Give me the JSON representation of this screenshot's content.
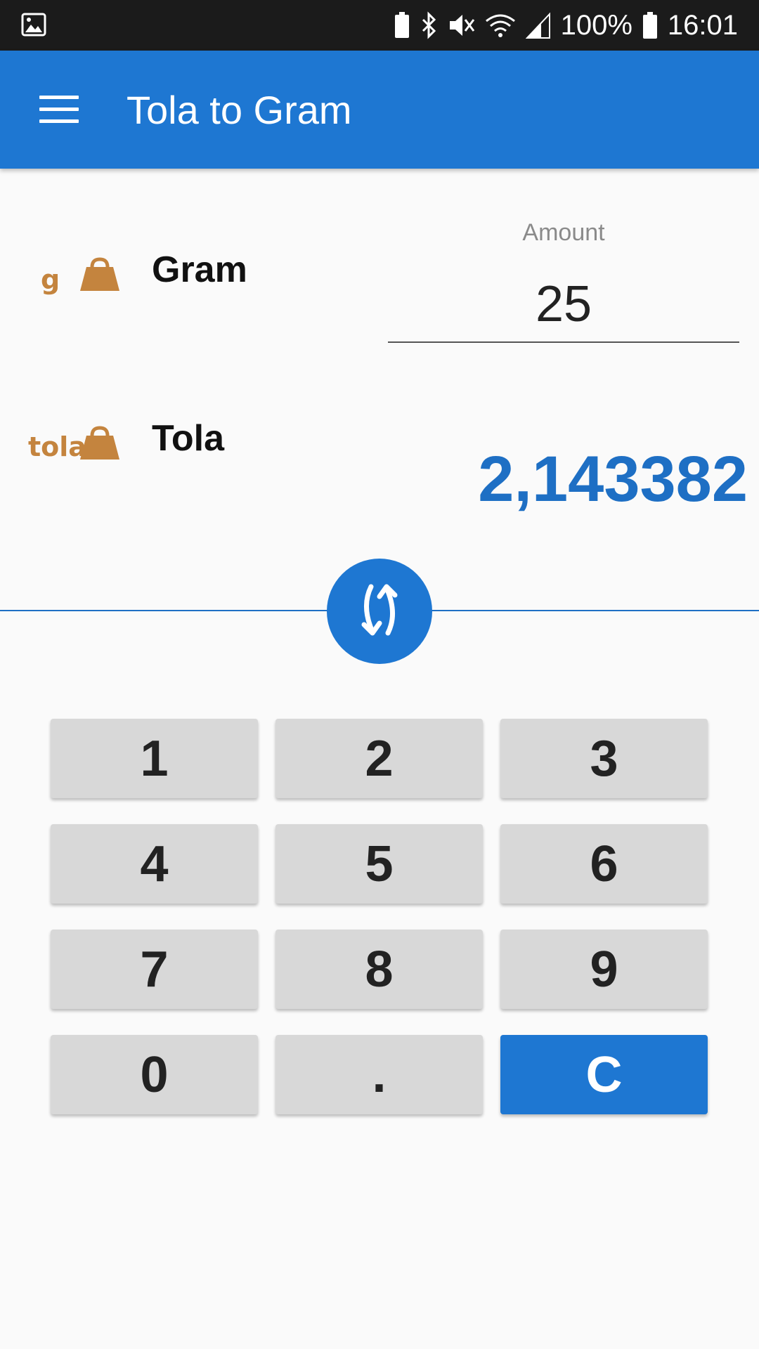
{
  "status_bar": {
    "battery": "100%",
    "time": "16:01"
  },
  "app_bar": {
    "title": "Tola to Gram",
    "menu_icon": "hamburger-menu-icon"
  },
  "from_unit": {
    "abbr": "g",
    "name": "Gram",
    "icon": "weight-icon"
  },
  "to_unit": {
    "abbr": "tola",
    "name": "Tola",
    "icon": "weight-icon"
  },
  "amount": {
    "label": "Amount",
    "value": "25"
  },
  "result": "2,143382",
  "swap_icon": "swap-arrows-icon",
  "keypad": [
    "1",
    "2",
    "3",
    "4",
    "5",
    "6",
    "7",
    "8",
    "9",
    "0",
    ".",
    "C"
  ],
  "colors": {
    "primary": "#1e77d2",
    "result": "#1e6fc4",
    "unit_icon": "#c4843e",
    "key_bg": "#d8d8d8"
  }
}
